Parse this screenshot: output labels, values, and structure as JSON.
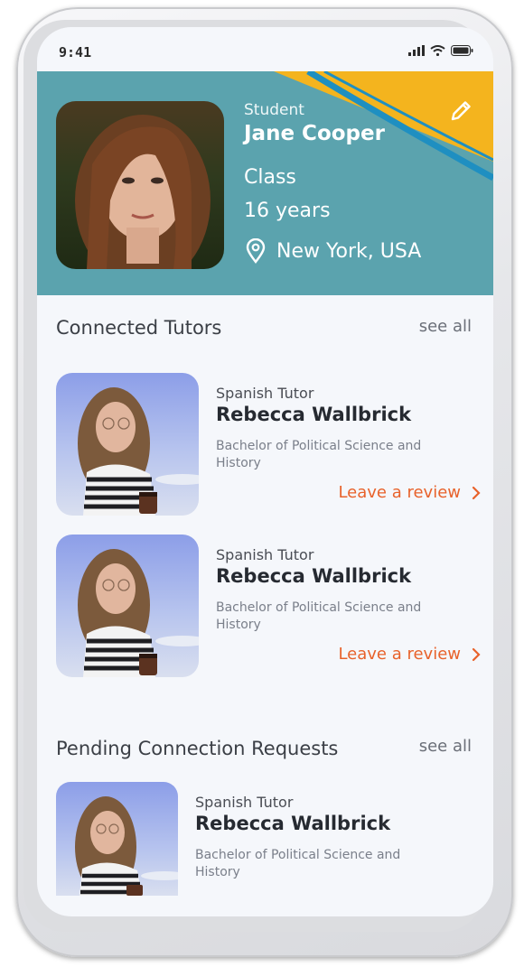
{
  "status": {
    "time": "9:41"
  },
  "profile": {
    "role": "Student",
    "name": "Jane Cooper",
    "class_label": "Class",
    "age": "16 years",
    "location": "New York, USA"
  },
  "connected": {
    "title": "Connected Tutors",
    "see_all": "see all",
    "items": [
      {
        "subject": "Spanish Tutor",
        "name": "Rebecca Wallbrick",
        "degree": "Bachelor of Political Science and History",
        "action": "Leave a review"
      },
      {
        "subject": "Spanish Tutor",
        "name": "Rebecca Wallbrick",
        "degree": "Bachelor of Political Science and History",
        "action": "Leave a review"
      }
    ]
  },
  "pending": {
    "title": "Pending Connection Requests",
    "see_all": "see all",
    "items": [
      {
        "subject": "Spanish Tutor",
        "name": "Rebecca Wallbrick",
        "degree": "Bachelor of Political Science and History"
      }
    ]
  },
  "icons": [
    "signal-icon",
    "wifi-icon",
    "battery-icon",
    "edit-icon",
    "location-pin-icon",
    "chevron-right-icon"
  ],
  "colors": {
    "header": "#5ba3ae",
    "accent_yellow": "#f4b41e",
    "accent_blue": "#1f8fc1",
    "action": "#e8622b",
    "background": "#f5f7fb"
  }
}
